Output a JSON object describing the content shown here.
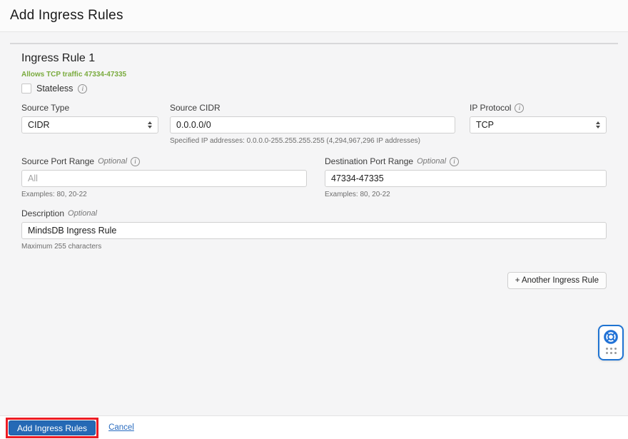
{
  "page": {
    "title": "Add Ingress Rules"
  },
  "rule": {
    "heading": "Ingress Rule 1",
    "note": "Allows TCP traffic 47334-47335",
    "stateless_label": "Stateless",
    "fields": {
      "source_type": {
        "label": "Source Type",
        "value": "CIDR"
      },
      "source_cidr": {
        "label": "Source CIDR",
        "value": "0.0.0.0/0",
        "helper": "Specified IP addresses: 0.0.0.0-255.255.255.255 (4,294,967,296 IP addresses)"
      },
      "ip_protocol": {
        "label": "IP Protocol",
        "value": "TCP"
      },
      "source_port_range": {
        "label": "Source Port Range",
        "optional": "Optional",
        "placeholder": "All",
        "helper": "Examples: 80, 20-22"
      },
      "destination_port_range": {
        "label": "Destination Port Range",
        "optional": "Optional",
        "value": "47334-47335",
        "helper": "Examples: 80, 20-22"
      },
      "description": {
        "label": "Description",
        "optional": "Optional",
        "value": "MindsDB Ingress Rule",
        "helper": "Maximum 255 characters"
      }
    },
    "another_rule_button": "+ Another Ingress Rule"
  },
  "footer": {
    "submit_label": "Add Ingress Rules",
    "cancel_label": "Cancel"
  },
  "icons": {
    "info": "info-icon",
    "select_chevrons": "chevron-up-down-icon",
    "help": "lifebuoy-help-icon",
    "drag_dots": "drag-handle-dots-icon"
  },
  "colors": {
    "primary_button_blue": "#2569b5",
    "annotation_red": "#ec1c24",
    "note_green": "#7aab3e",
    "link_blue": "#2a6cc0",
    "help_border_blue": "#1e73d2"
  }
}
